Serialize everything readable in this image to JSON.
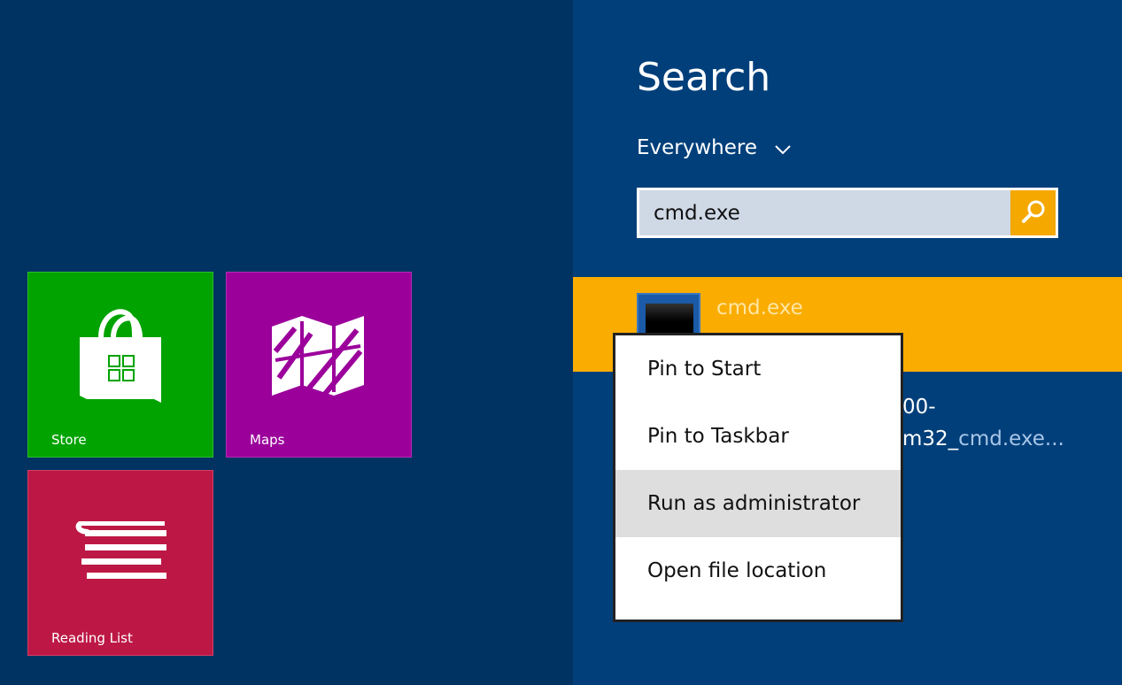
{
  "tiles": [
    {
      "label": "Store",
      "color": "#00a300",
      "icon": "store-bag-icon"
    },
    {
      "label": "Maps",
      "color": "#9b009b",
      "icon": "map-icon"
    },
    {
      "label": "Reading List",
      "color": "#bd1845",
      "icon": "reading-list-icon"
    }
  ],
  "search": {
    "title": "Search",
    "scope": "Everywhere",
    "query": "cmd.exe",
    "button_icon": "magnifier-icon",
    "accent": "#f4a800"
  },
  "results": [
    {
      "name": "cmd.exe",
      "icon": "console-icon",
      "highlight": "#fbac00"
    },
    {
      "line1": "00-",
      "line2_prefix": "m32_",
      "line2_match": "cmd.exe..."
    }
  ],
  "context_menu": {
    "items": [
      "Pin to Start",
      "Pin to Taskbar",
      "Run as administrator",
      "Open file location"
    ],
    "active_index": 2
  }
}
